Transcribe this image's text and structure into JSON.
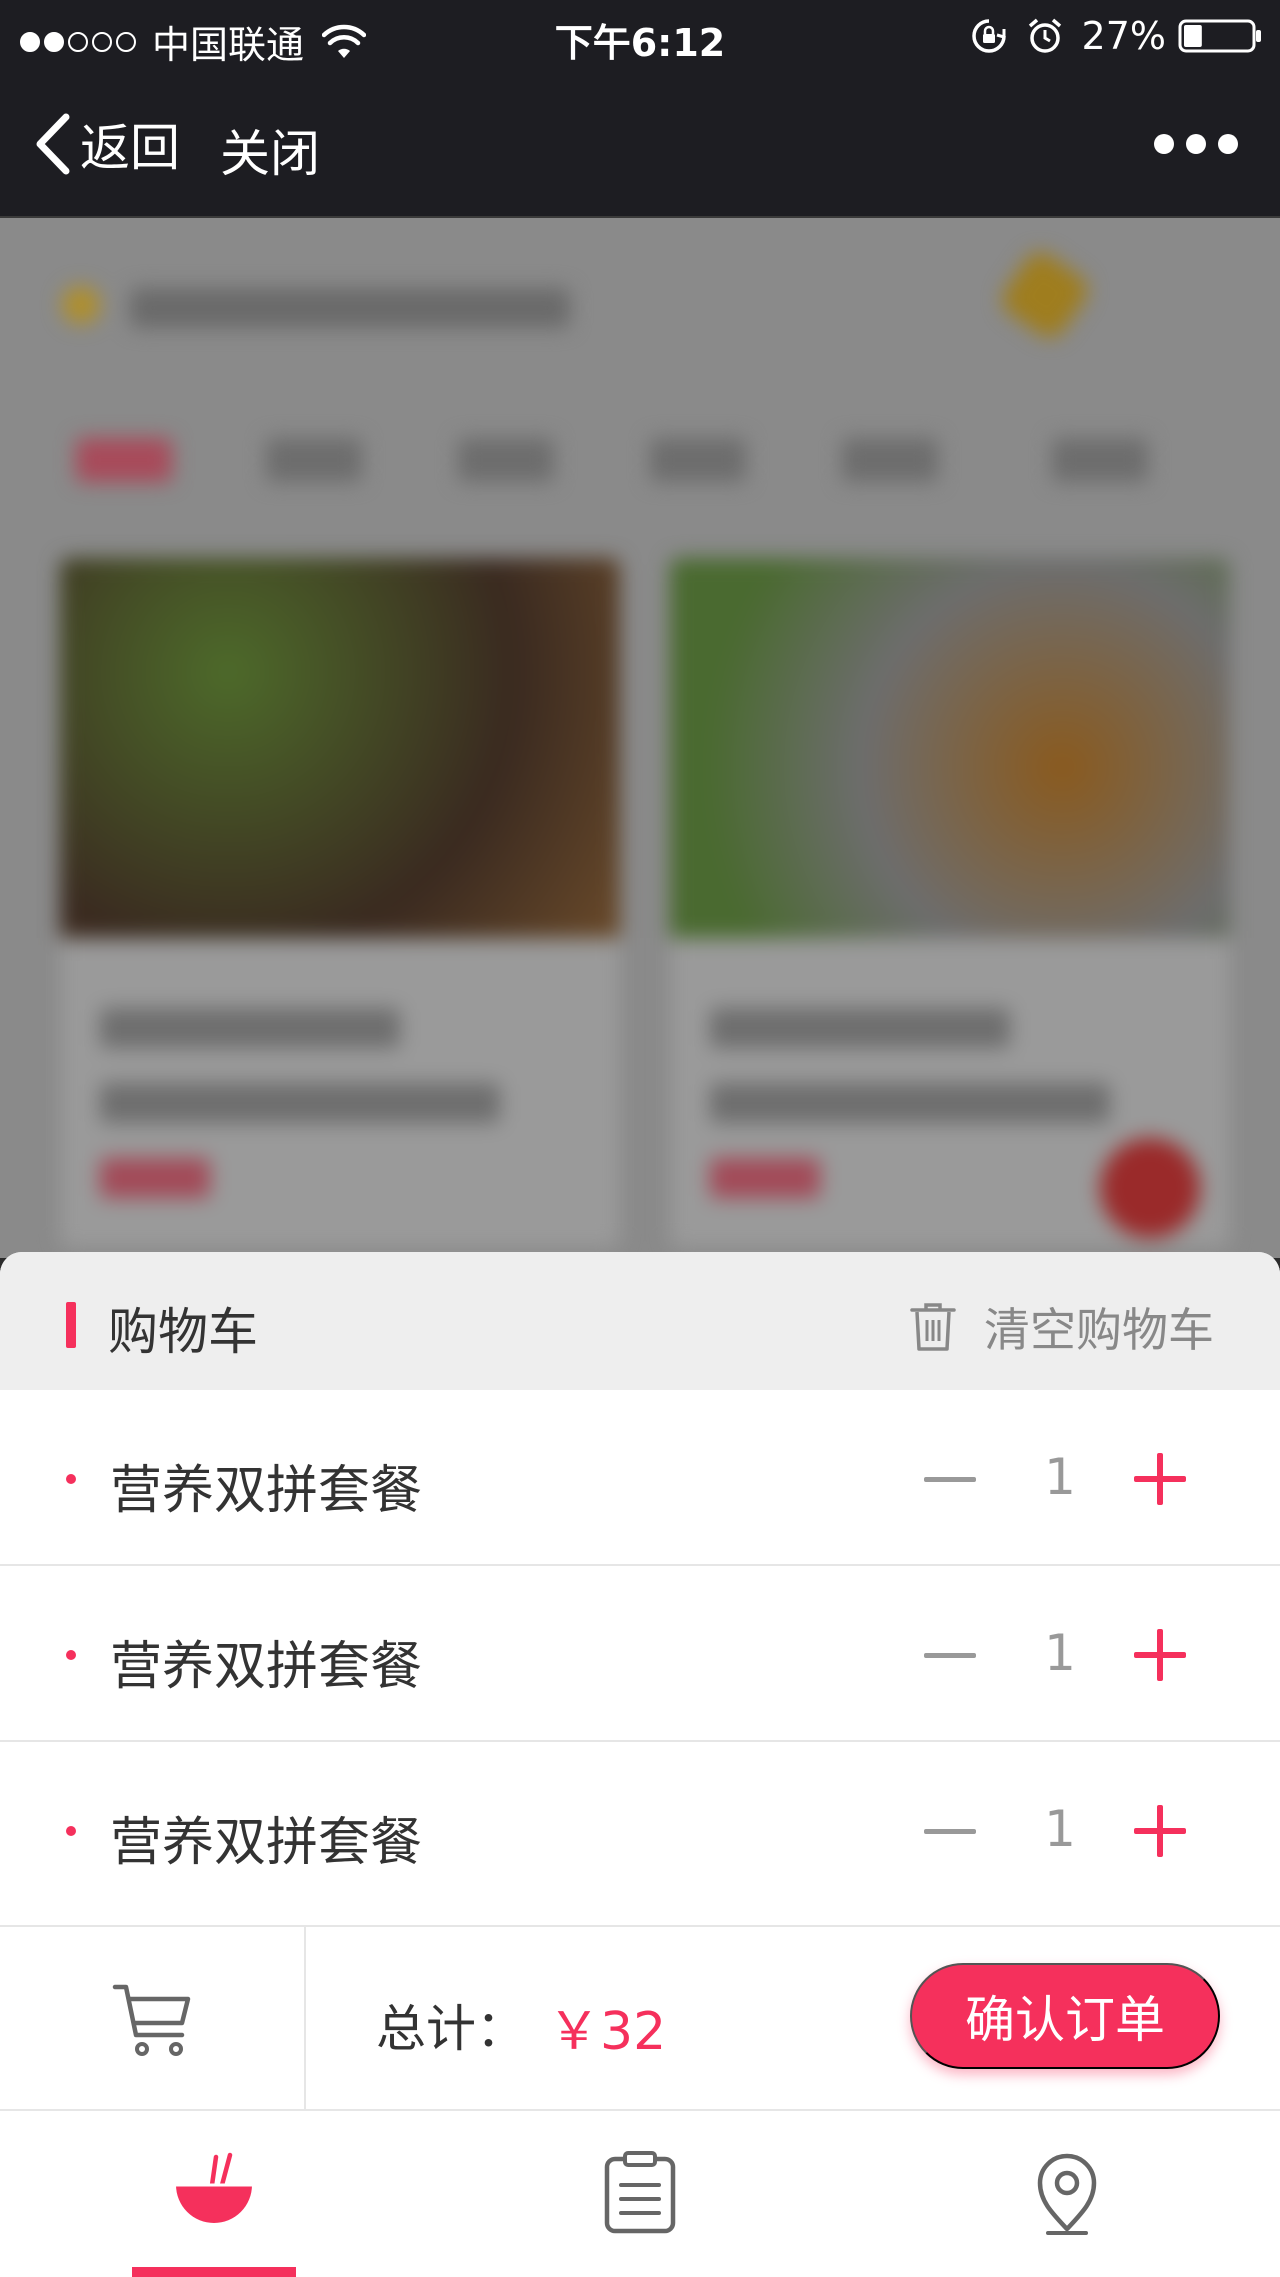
{
  "status_bar": {
    "carrier": "中国联通",
    "time": "下午6:12",
    "battery": "27%",
    "battery_level": 0.27,
    "signal_bars_filled": 2,
    "signal_bars_total": 5
  },
  "nav": {
    "back_label": "返回",
    "close_label": "关闭"
  },
  "cart": {
    "title": "购物车",
    "clear_label": "清空购物车",
    "items": [
      {
        "name": "营养双拼套餐",
        "qty": "1"
      },
      {
        "name": "营养双拼套餐",
        "qty": "1"
      },
      {
        "name": "营养双拼套餐",
        "qty": "1"
      }
    ]
  },
  "checkout": {
    "total_label": "总计：",
    "total_value": "￥32",
    "confirm_label": "确认订单"
  },
  "tab_bar": {
    "active_tab": "menu",
    "tabs": [
      "bowl-icon",
      "order-list-icon",
      "location-icon"
    ]
  },
  "colors": {
    "accent": "#f5305c",
    "nav_background": "#1d1d22",
    "header_background": "#eeeeee"
  }
}
